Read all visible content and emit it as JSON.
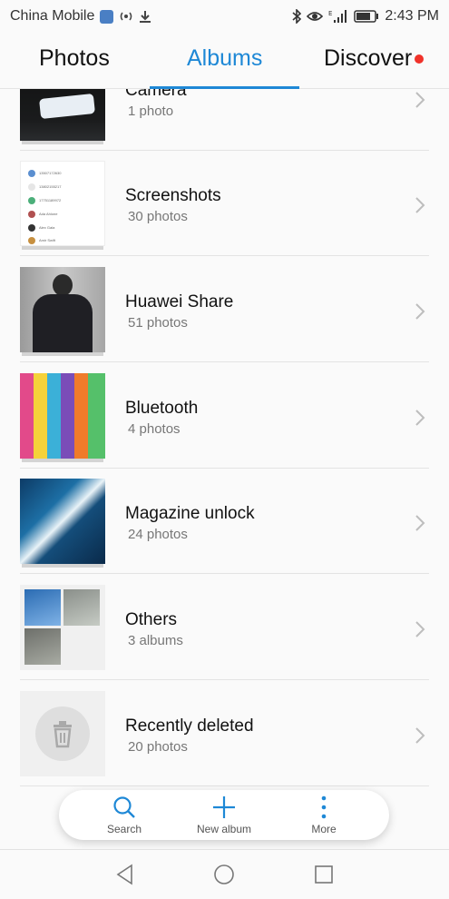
{
  "status_bar": {
    "carrier": "China Mobile",
    "time": "2:43 PM",
    "network_type": "E"
  },
  "tabs": [
    {
      "label": "Photos",
      "active": false
    },
    {
      "label": "Albums",
      "active": true
    },
    {
      "label": "Discover",
      "active": false,
      "has_badge": true
    }
  ],
  "albums": [
    {
      "title": "Camera",
      "subtitle": "1 photo"
    },
    {
      "title": "Screenshots",
      "subtitle": "30 photos"
    },
    {
      "title": "Huawei Share",
      "subtitle": "51 photos"
    },
    {
      "title": "Bluetooth",
      "subtitle": "4 photos"
    },
    {
      "title": "Magazine unlock",
      "subtitle": "24 photos"
    },
    {
      "title": "Others",
      "subtitle": "3 albums"
    },
    {
      "title": "Recently deleted",
      "subtitle": "20 photos"
    }
  ],
  "screenshot_thumb_lines": [
    "13507172630",
    "13802155217",
    "17751189972",
    "Ada Ahlone",
    "Alex Gala",
    "Amir Swift"
  ],
  "action_bar": {
    "search_label": "Search",
    "new_album_label": "New album",
    "more_label": "More"
  },
  "colors": {
    "accent": "#1e88d6",
    "badge": "#f0322a"
  }
}
